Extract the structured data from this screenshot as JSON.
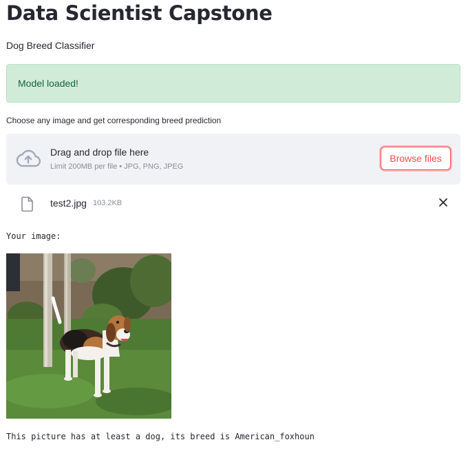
{
  "page": {
    "title": "Data Scientist Capstone",
    "subtitle": "Dog Breed Classifier"
  },
  "alert": {
    "message": "Model loaded!",
    "status": "success",
    "bg_color": "#d0ecd8",
    "text_color": "#19613a"
  },
  "uploader": {
    "label": "Choose any image and get corresponding breed prediction",
    "drop_text": "Drag and drop file here",
    "limit_text": "Limit 200MB per file • JPG, PNG, JPEG",
    "browse_label": "Browse files",
    "icon": "cloud-upload-icon",
    "accent_color": "#ff4b4b"
  },
  "uploaded_file": {
    "name": "test2.jpg",
    "size": "103.2KB",
    "icon": "file-icon",
    "remove_icon": "close-icon"
  },
  "output": {
    "image_label": "Your image:",
    "image_subject": "beagle dog standing on grass",
    "result_text": "This picture has at least a dog, its breed is American_foxhoun"
  }
}
